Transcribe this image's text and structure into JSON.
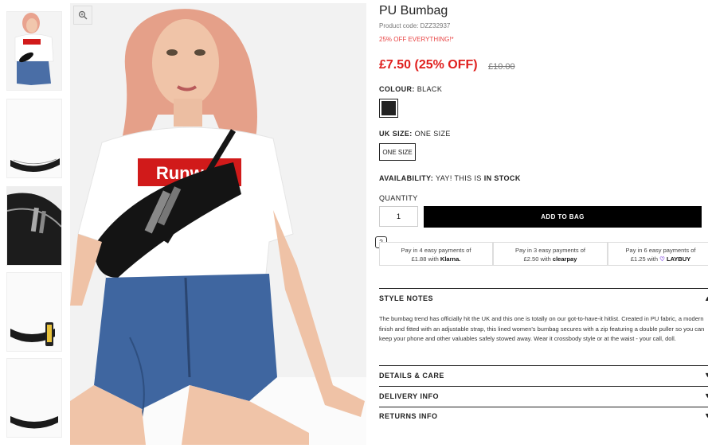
{
  "product": {
    "title": "PU Bumbag",
    "product_code": "Product code: DZZ32937",
    "promo": "25% OFF EVERYTHING!*",
    "price": "£7.50 (25% OFF)",
    "old_price": "£10.00"
  },
  "colour": {
    "label": "COLOUR:",
    "value": "BLACK",
    "swatch_color": "#222222"
  },
  "size": {
    "label": "UK SIZE:",
    "value": "ONE SIZE",
    "option": "ONE SIZE"
  },
  "availability": {
    "label": "AVAILABILITY:",
    "text": "YAY! THIS IS",
    "status": "IN STOCK"
  },
  "quantity": {
    "label": "QUANTITY",
    "value": "1"
  },
  "add_to_bag": "ADD TO BAG",
  "help_icon_text": "?",
  "payments": [
    {
      "line1": "Pay in 4 easy payments of",
      "amount": "£1.88 with",
      "brand": "Klarna."
    },
    {
      "line1": "Pay in 3 easy payments of",
      "amount": "£2.50 with",
      "brand": "clearpay"
    },
    {
      "line1": "Pay in 6 easy payments of",
      "amount": "£1.25 with",
      "brand": "LAYBUY"
    }
  ],
  "style_notes": {
    "title": "STYLE NOTES",
    "text": "The bumbag trend has officially hit the UK and this one is totally on our got-to-have-it hitlist. Created in PU fabric, a modern finish and fitted with an adjustable strap, this lined women's bumbag secures with a zip featuring a double puller so you can keep your phone and other valuables safely stowed away. Wear it crossbody style or at the waist - your call, doll."
  },
  "sections": [
    "DETAILS & CARE",
    "DELIVERY INFO",
    "RETURNS INFO"
  ],
  "image_text": {
    "tshirt_print": "Runway"
  },
  "colors": {
    "price_red": "#e0201e",
    "promo_red": "#e84545",
    "button_black": "#000000"
  },
  "icons": {
    "zoom": "zoom-icon",
    "chevron": "chevron-down-icon",
    "help": "question-icon"
  }
}
